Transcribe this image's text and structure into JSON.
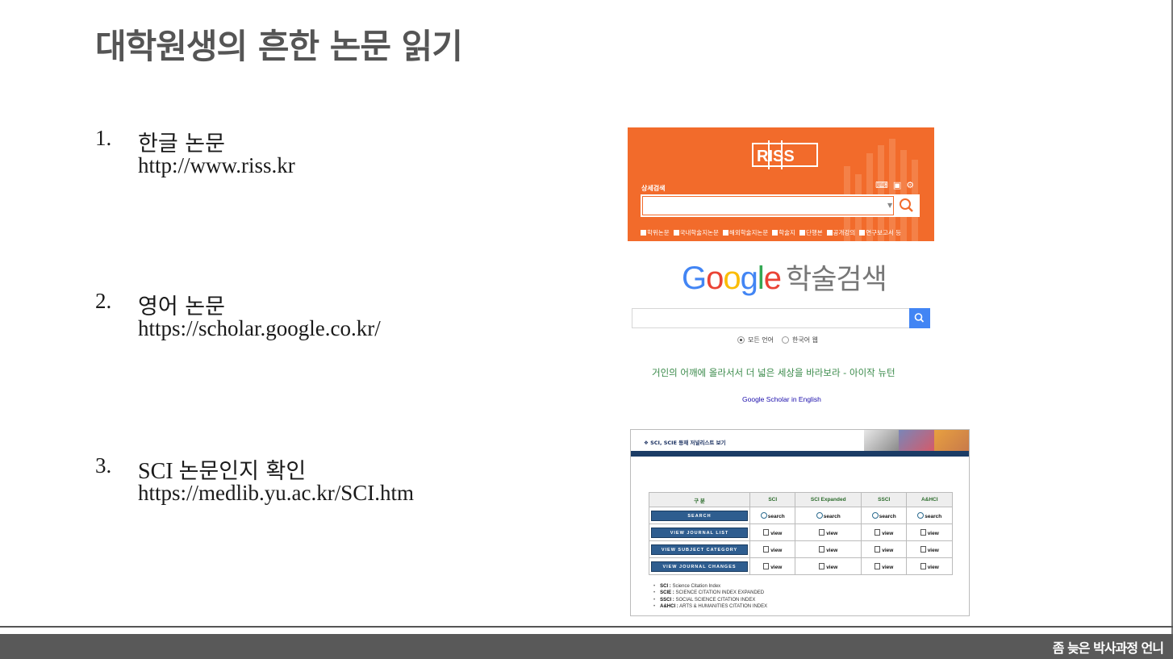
{
  "slide": {
    "title": "대학원생의 흔한 논문 읽기",
    "items": [
      {
        "num": "1.",
        "label": "한글 논문",
        "url": "http://www.riss.kr"
      },
      {
        "num": "2.",
        "label": "영어 논문",
        "url": "https://scholar.google.co.kr/"
      },
      {
        "num": "3.",
        "label_prefix": "SCI ",
        "label": "논문인지 확인",
        "url": "https://medlib.yu.ac.kr/SCI.htm"
      }
    ]
  },
  "riss": {
    "logo": "RISS",
    "detail_search": "상세검색",
    "checkboxes": [
      "학위논문",
      "국내학술지논문",
      "해외학술지논문",
      "학술지",
      "단행본",
      "공개강의",
      "연구보고서 등"
    ],
    "accent": "#f26b2b"
  },
  "scholar": {
    "logo_letters": [
      "G",
      "o",
      "o",
      "g",
      "l",
      "e"
    ],
    "logo_suffix": "학술검색",
    "radio_all": "모든 언어",
    "radio_korean": "한국어 웹",
    "quote": "거인의 어깨에 올라서서 더 넓은 세상을 바라보라 - 아이작 뉴턴",
    "english_link": "Google Scholar in English"
  },
  "sci": {
    "header_title": "❖ SCI, SCIE 등재 저널리스트 보기",
    "columns": [
      "구 분",
      "SCI",
      "SCI Expanded",
      "SSCI",
      "A&HCI"
    ],
    "rows": [
      {
        "button": "SEARCH",
        "cell": "search"
      },
      {
        "button": "VIEW JOURNAL LIST",
        "cell": "view"
      },
      {
        "button": "VIEW SUBJECT CATEGORY",
        "cell": "view"
      },
      {
        "button": "VIEW JOURNAL CHANGES",
        "cell": "view"
      }
    ],
    "legend": [
      {
        "abbr": "SCI :",
        "text": " Science Citation Index"
      },
      {
        "abbr": "SCIE :",
        "text": " SCIENCE CITATION INDEX EXPANDED"
      },
      {
        "abbr": "SSCI :",
        "text": " SOCIAL SCIENCE CITATION INDEX"
      },
      {
        "abbr": "A&HCI :",
        "text": " ARTS & HUMANITIES CITATION INDEX"
      }
    ]
  },
  "footer": {
    "brand": "좀 늦은 박사과정 언니"
  }
}
